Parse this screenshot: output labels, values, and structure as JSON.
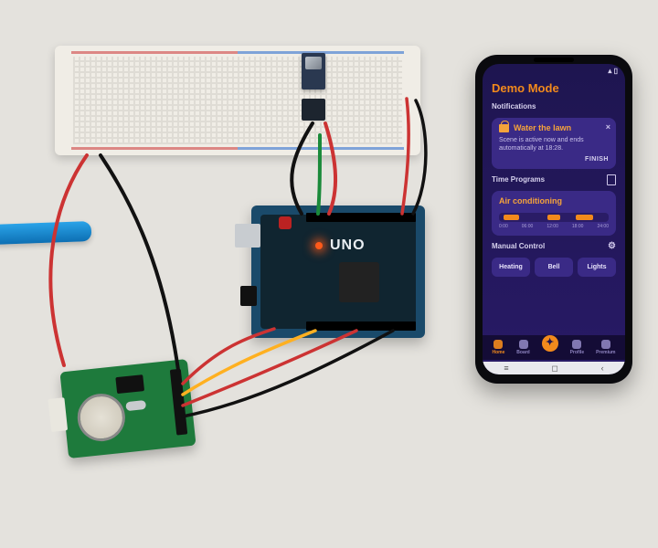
{
  "hardware": {
    "board_label": "UNO"
  },
  "phone": {
    "status_time": "",
    "title": "Demo Mode",
    "sections": {
      "notifications": "Notifications",
      "time_programs": "Time Programs",
      "manual_control": "Manual Control"
    },
    "notification": {
      "title": "Water the lawn",
      "body": "Scene is active now and ends automatically at 18:28.",
      "action": "FINISH",
      "close": "×"
    },
    "program": {
      "title": "Air conditioning",
      "ticks": [
        "0:00",
        "06:00",
        "12:00",
        "18:00",
        "24:00"
      ],
      "segments": [
        {
          "start_pct": 4,
          "width_pct": 14
        },
        {
          "start_pct": 44,
          "width_pct": 12
        },
        {
          "start_pct": 70,
          "width_pct": 16
        }
      ]
    },
    "controls": [
      "Heating",
      "Bell",
      "Lights"
    ],
    "nav": [
      {
        "label": "Home",
        "active": true
      },
      {
        "label": "Board",
        "active": false
      },
      {
        "label": "",
        "star": true
      },
      {
        "label": "Profile",
        "active": false
      },
      {
        "label": "Premium",
        "active": false
      }
    ],
    "softkeys": [
      "≡",
      "◻",
      "‹"
    ]
  }
}
